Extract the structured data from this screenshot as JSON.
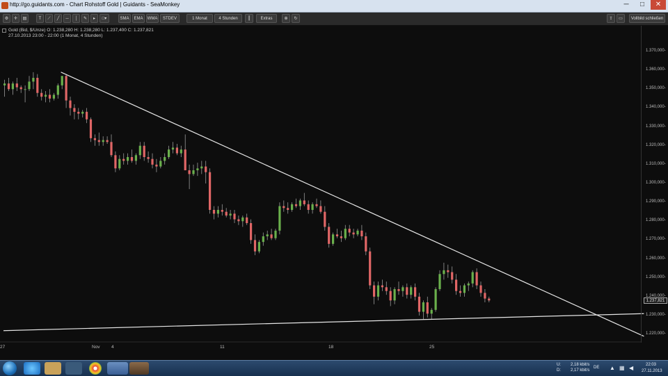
{
  "browser": {
    "title": "http://go.guidants.com - Chart Rohstoff Gold | Guidants - SeaMonkey",
    "min_glyph": "─",
    "max_glyph": "□",
    "close_glyph": "✕"
  },
  "toolbar": {
    "sma_label": "SMA",
    "ema_label": "EMA",
    "wma_label": "WMA",
    "stdev_label": "STDEV",
    "timeframe_label": "1 Monat",
    "interval_label": "4 Stunden",
    "extras_label": "Extras",
    "fullscreen_close_label": "Vollbild schließen"
  },
  "instrument": {
    "quote_line": "Gold (Bid, $/Unze)  O: 1.238,280  H: 1.238,280  L: 1.237,400  C: 1.237,821",
    "range_line": "27.10.2013 23:00 - 22:00 (1 Monat, 4 Stunden)",
    "last_price_label": "1.237,821"
  },
  "chart_data": {
    "type": "candlestick",
    "y_axis": {
      "range": [
        1216,
        1377
      ],
      "tick_labels": [
        "1.370,000-",
        "1.360,000-",
        "1.350,000-",
        "1.340,000-",
        "1.330,000-",
        "1.320,000-",
        "1.310,000-",
        "1.300,000-",
        "1.290,000-",
        "1.280,000-",
        "1.270,000-",
        "1.260,000-",
        "1.250,000-",
        "1.240,000-",
        "1.230,000-",
        "1.220,000-"
      ]
    },
    "x_axis": {
      "tick_labels": [
        "27",
        "Nov",
        "4",
        "11",
        "18",
        "25"
      ]
    },
    "colors": {
      "up": "#6ab04c",
      "down": "#e06666",
      "trendline": "#e6e6e6",
      "background": "#0d0d0d"
    },
    "trendlines": [
      {
        "name": "resistance",
        "from": {
          "bar": 14,
          "price": 1359
        },
        "to": {
          "bar": 156,
          "price": 1219
        }
      },
      {
        "name": "support",
        "from": {
          "bar": 0,
          "price": 1222
        },
        "to": {
          "bar": 156,
          "price": 1231
        }
      }
    ],
    "candles": [
      [
        1352,
        1355,
        1346,
        1353
      ],
      [
        1353,
        1356,
        1349,
        1350
      ],
      [
        1350,
        1354,
        1347,
        1353
      ],
      [
        1353,
        1356,
        1349,
        1351
      ],
      [
        1351,
        1352,
        1348,
        1350
      ],
      [
        1350,
        1352,
        1343,
        1350
      ],
      [
        1350,
        1357,
        1349,
        1354
      ],
      [
        1354,
        1359,
        1350,
        1356
      ],
      [
        1356,
        1358,
        1346,
        1348
      ],
      [
        1348,
        1350,
        1344,
        1346
      ],
      [
        1346,
        1349,
        1343,
        1347
      ],
      [
        1347,
        1350,
        1343,
        1345
      ],
      [
        1345,
        1348,
        1344,
        1347
      ],
      [
        1347,
        1353,
        1345,
        1352
      ],
      [
        1352,
        1357,
        1350,
        1357
      ],
      [
        1357,
        1358,
        1340,
        1344
      ],
      [
        1344,
        1346,
        1336,
        1340
      ],
      [
        1340,
        1342,
        1334,
        1338
      ],
      [
        1338,
        1340,
        1334,
        1337
      ],
      [
        1337,
        1339,
        1335,
        1338
      ],
      [
        1338,
        1340,
        1332,
        1334
      ],
      [
        1334,
        1335,
        1322,
        1324
      ],
      [
        1324,
        1326,
        1320,
        1323
      ],
      [
        1323,
        1327,
        1320,
        1322
      ],
      [
        1322,
        1325,
        1320,
        1323
      ],
      [
        1323,
        1325,
        1321,
        1322
      ],
      [
        1322,
        1326,
        1314,
        1315
      ],
      [
        1315,
        1317,
        1306,
        1308
      ],
      [
        1308,
        1315,
        1307,
        1313
      ],
      [
        1313,
        1316,
        1310,
        1312
      ],
      [
        1312,
        1316,
        1310,
        1314
      ],
      [
        1314,
        1318,
        1311,
        1312
      ],
      [
        1312,
        1316,
        1310,
        1315
      ],
      [
        1315,
        1322,
        1313,
        1320
      ],
      [
        1320,
        1322,
        1312,
        1314
      ],
      [
        1314,
        1317,
        1311,
        1313
      ],
      [
        1313,
        1316,
        1308,
        1310
      ],
      [
        1310,
        1313,
        1306,
        1309
      ],
      [
        1309,
        1314,
        1308,
        1312
      ],
      [
        1312,
        1316,
        1310,
        1314
      ],
      [
        1314,
        1320,
        1313,
        1318
      ],
      [
        1318,
        1322,
        1316,
        1319
      ],
      [
        1319,
        1321,
        1315,
        1316
      ],
      [
        1316,
        1320,
        1314,
        1318
      ],
      [
        1318,
        1326,
        1316,
        1307
      ],
      [
        1307,
        1310,
        1297,
        1305
      ],
      [
        1305,
        1310,
        1304,
        1307
      ],
      [
        1307,
        1311,
        1304,
        1308
      ],
      [
        1308,
        1312,
        1305,
        1309
      ],
      [
        1309,
        1312,
        1300,
        1306
      ],
      [
        1306,
        1308,
        1284,
        1286
      ],
      [
        1286,
        1288,
        1281,
        1284
      ],
      [
        1284,
        1288,
        1282,
        1286
      ],
      [
        1286,
        1289,
        1283,
        1285
      ],
      [
        1285,
        1287,
        1282,
        1283
      ],
      [
        1283,
        1286,
        1281,
        1284
      ],
      [
        1284,
        1286,
        1279,
        1281
      ],
      [
        1281,
        1283,
        1278,
        1280
      ],
      [
        1280,
        1283,
        1277,
        1282
      ],
      [
        1282,
        1284,
        1278,
        1279
      ],
      [
        1279,
        1281,
        1268,
        1270
      ],
      [
        1270,
        1273,
        1262,
        1264
      ],
      [
        1264,
        1270,
        1263,
        1269
      ],
      [
        1269,
        1274,
        1267,
        1272
      ],
      [
        1272,
        1275,
        1270,
        1273
      ],
      [
        1273,
        1276,
        1270,
        1271
      ],
      [
        1271,
        1276,
        1270,
        1275
      ],
      [
        1275,
        1290,
        1273,
        1288
      ],
      [
        1288,
        1291,
        1285,
        1287
      ],
      [
        1287,
        1290,
        1284,
        1286
      ],
      [
        1286,
        1290,
        1285,
        1289
      ],
      [
        1289,
        1292,
        1287,
        1288
      ],
      [
        1288,
        1292,
        1286,
        1291
      ],
      [
        1291,
        1295,
        1288,
        1289
      ],
      [
        1289,
        1291,
        1284,
        1286
      ],
      [
        1286,
        1290,
        1284,
        1289
      ],
      [
        1289,
        1292,
        1287,
        1288
      ],
      [
        1288,
        1291,
        1284,
        1285
      ],
      [
        1285,
        1288,
        1275,
        1277
      ],
      [
        1277,
        1279,
        1266,
        1268
      ],
      [
        1268,
        1274,
        1267,
        1273
      ],
      [
        1273,
        1276,
        1271,
        1272
      ],
      [
        1272,
        1275,
        1269,
        1271
      ],
      [
        1271,
        1278,
        1270,
        1276
      ],
      [
        1276,
        1278,
        1272,
        1274
      ],
      [
        1274,
        1276,
        1271,
        1273
      ],
      [
        1273,
        1276,
        1272,
        1275
      ],
      [
        1275,
        1278,
        1270,
        1272
      ],
      [
        1272,
        1274,
        1262,
        1264
      ],
      [
        1264,
        1266,
        1244,
        1246
      ],
      [
        1246,
        1248,
        1236,
        1240
      ],
      [
        1240,
        1248,
        1238,
        1246
      ],
      [
        1246,
        1249,
        1243,
        1245
      ],
      [
        1245,
        1248,
        1241,
        1243
      ],
      [
        1243,
        1245,
        1235,
        1238
      ],
      [
        1238,
        1245,
        1236,
        1244
      ],
      [
        1244,
        1248,
        1241,
        1243
      ],
      [
        1243,
        1246,
        1240,
        1245
      ],
      [
        1245,
        1247,
        1239,
        1241
      ],
      [
        1241,
        1246,
        1239,
        1245
      ],
      [
        1245,
        1247,
        1238,
        1240
      ],
      [
        1240,
        1242,
        1230,
        1232
      ],
      [
        1232,
        1238,
        1228,
        1237
      ],
      [
        1237,
        1240,
        1229,
        1231
      ],
      [
        1231,
        1234,
        1228,
        1233
      ],
      [
        1233,
        1245,
        1232,
        1244
      ],
      [
        1244,
        1254,
        1243,
        1252
      ],
      [
        1252,
        1258,
        1249,
        1254
      ],
      [
        1254,
        1257,
        1250,
        1253
      ],
      [
        1253,
        1256,
        1247,
        1249
      ],
      [
        1249,
        1252,
        1241,
        1243
      ],
      [
        1243,
        1246,
        1240,
        1242
      ],
      [
        1242,
        1247,
        1240,
        1246
      ],
      [
        1246,
        1248,
        1243,
        1247
      ],
      [
        1247,
        1254,
        1245,
        1253
      ],
      [
        1253,
        1255,
        1244,
        1246
      ],
      [
        1246,
        1248,
        1240,
        1242
      ],
      [
        1242,
        1244,
        1237,
        1239
      ],
      [
        1239,
        1240,
        1237,
        1238
      ]
    ]
  },
  "taskbar": {
    "tray_up": "U:",
    "tray_up_rate": "2,18 kbit/s",
    "tray_down": "D:",
    "tray_down_rate": "2,17 kbit/s",
    "tray_lang": "DE",
    "clock_time": "22:03",
    "clock_date": "27.11.2013"
  }
}
